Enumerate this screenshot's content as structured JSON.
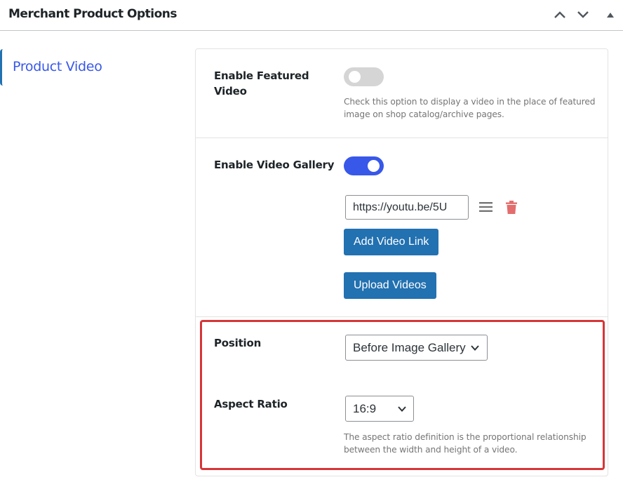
{
  "header": {
    "title": "Merchant Product Options"
  },
  "nav": {
    "items": [
      {
        "label": "Product Video"
      }
    ]
  },
  "featured_video": {
    "label": "Enable Featured Video",
    "enabled": false,
    "description": "Check this option to display a video in the place of featured image on shop catalog/archive pages."
  },
  "video_gallery": {
    "label": "Enable Video Gallery",
    "enabled": true,
    "links": [
      {
        "value": "https://youtu.be/5U"
      }
    ],
    "add_link_label": "Add Video Link",
    "upload_label": "Upload Videos"
  },
  "position": {
    "label": "Position",
    "selected": "Before Image Gallery"
  },
  "aspect_ratio": {
    "label": "Aspect Ratio",
    "selected": "16:9",
    "description": "The aspect ratio definition is the proportional relationship between the width and height of a video."
  },
  "colors": {
    "accent": "#3858e9",
    "button": "#2271b1",
    "delete": "#d63638",
    "highlight": "#d63638"
  }
}
